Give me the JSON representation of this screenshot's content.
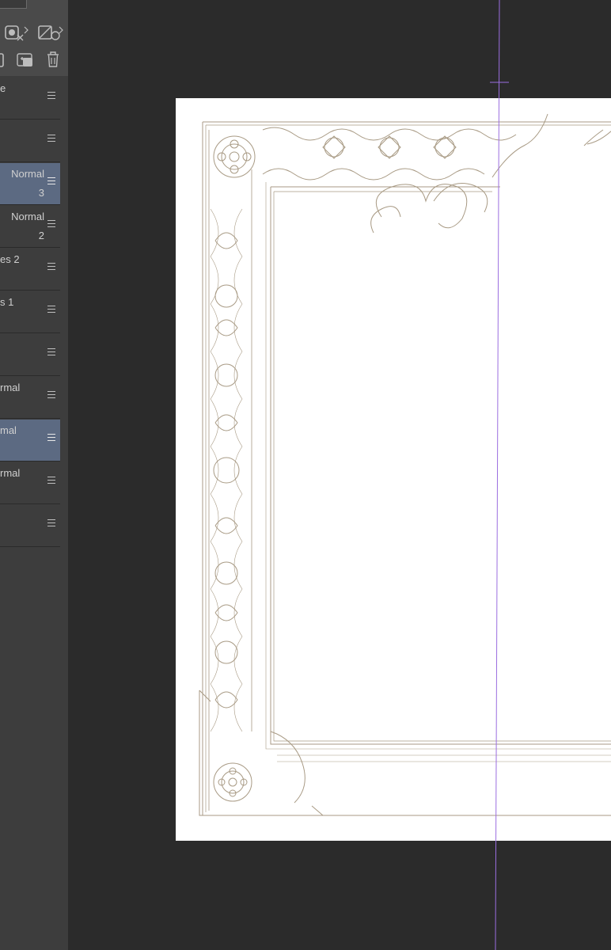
{
  "layers_panel": {
    "toolbar_icons": [
      "adjust-visibility-icon",
      "new-layer-icon",
      "new-folder-icon",
      "layer-mask-icon",
      "delete-layer-icon"
    ],
    "layers": [
      {
        "line1": "e",
        "line2": "",
        "selected": false,
        "align": "left"
      },
      {
        "line1": "",
        "line2": "",
        "selected": false,
        "align": "left"
      },
      {
        "line1": "Normal",
        "line2": "3",
        "selected": true,
        "align": "right"
      },
      {
        "line1": "Normal",
        "line2": "2",
        "selected": false,
        "align": "right"
      },
      {
        "line1": "es 2",
        "line2": "",
        "selected": false,
        "align": "left"
      },
      {
        "line1": "s 1",
        "line2": "",
        "selected": false,
        "align": "left"
      },
      {
        "line1": "",
        "line2": "",
        "selected": false,
        "align": "left"
      },
      {
        "line1": "rmal",
        "line2": "",
        "selected": false,
        "align": "left"
      },
      {
        "line1": "mal",
        "line2": "",
        "selected": true,
        "align": "left"
      },
      {
        "line1": "rmal",
        "line2": "",
        "selected": false,
        "align": "left"
      },
      {
        "line1": "",
        "line2": "",
        "selected": false,
        "align": "left"
      }
    ]
  },
  "canvas": {
    "background": "#2b2b2b",
    "page_color": "#ffffff",
    "ornament_color": "#a89a84",
    "guide_color": "#9b6ee0"
  }
}
